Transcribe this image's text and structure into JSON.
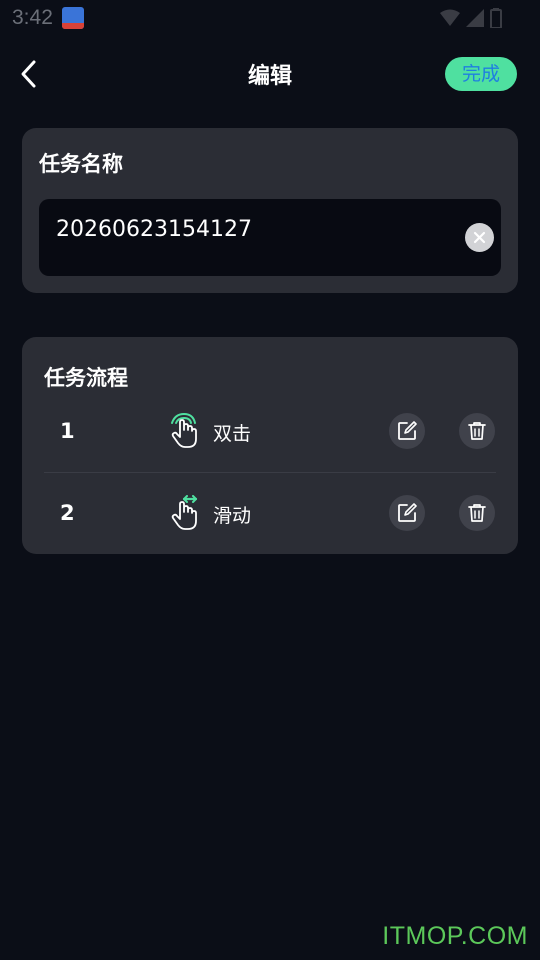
{
  "status_bar": {
    "time": "3:42",
    "icons": [
      "app-notification-icon",
      "wifi-icon",
      "signal-icon",
      "battery-icon"
    ]
  },
  "header": {
    "back_icon": "chevron-left-icon",
    "title": "编辑",
    "done_label": "完成"
  },
  "task_name_card": {
    "title": "任务名称",
    "input_value": "20260623154127",
    "clear_icon": "clear-icon"
  },
  "task_flow_card": {
    "title": "任务流程",
    "steps": [
      {
        "number": "1",
        "icon": "double-tap-hand-icon",
        "label": "双击",
        "edit_icon": "edit-icon",
        "delete_icon": "trash-icon"
      },
      {
        "number": "2",
        "icon": "swipe-hand-icon",
        "label": "滑动",
        "edit_icon": "edit-icon",
        "delete_icon": "trash-icon"
      }
    ]
  },
  "watermark": "ITMOP.COM",
  "colors": {
    "background": "#0b0e17",
    "card": "#2b2d35",
    "input": "#080a12",
    "accent_green": "#4fe0a0",
    "accent_blue": "#1f7fe0",
    "watermark_green": "#5cc85a"
  }
}
